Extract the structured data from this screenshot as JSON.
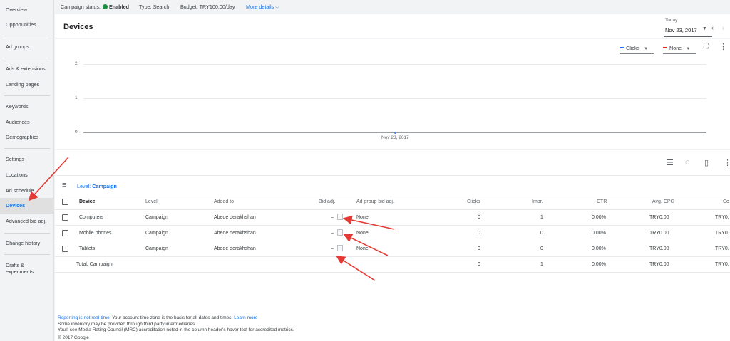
{
  "sidebar": {
    "items": [
      {
        "label": "Overview",
        "active": false
      },
      {
        "label": "Opportunities",
        "active": false
      },
      {
        "label": "Ad groups",
        "active": false
      },
      {
        "label": "Ads & extensions",
        "active": false
      },
      {
        "label": "Landing pages",
        "active": false
      },
      {
        "label": "Keywords",
        "active": false
      },
      {
        "label": "Audiences",
        "active": false
      },
      {
        "label": "Demographics",
        "active": false
      },
      {
        "label": "Settings",
        "active": false
      },
      {
        "label": "Locations",
        "active": false
      },
      {
        "label": "Ad schedule",
        "active": false
      },
      {
        "label": "Devices",
        "active": true
      },
      {
        "label": "Advanced bid adj.",
        "active": false
      },
      {
        "label": "Change history",
        "active": false
      },
      {
        "label": "Drafts &",
        "active": false
      },
      {
        "label": "experiments",
        "active": false
      }
    ]
  },
  "topbar": {
    "status_label": "Campaign status:",
    "status_value": "Enabled",
    "type": "Type: Search",
    "budget": "Budget: TRY100.00/day",
    "more_details": "More details"
  },
  "header": {
    "title": "Devices",
    "today_label": "Today",
    "date": "Nov 23, 2017"
  },
  "chart": {
    "metric1": "Clicks",
    "metric1_color": "#1a73e8",
    "metric2": "None",
    "metric2_color": "#d93025"
  },
  "chart_data": {
    "type": "line",
    "x": [
      "Nov 23, 2017"
    ],
    "series": [
      {
        "name": "Clicks",
        "values": [
          0
        ]
      }
    ],
    "yticks": [
      "2",
      "1",
      "0"
    ],
    "ylim": [
      0,
      2
    ],
    "grid": true
  },
  "table": {
    "level_prefix": "Level:",
    "level_value": "Campaign",
    "headers": {
      "device": "Device",
      "level": "Level",
      "added_to": "Added to",
      "bid_adj": "Bid adj.",
      "ag_bid_adj": "Ad group bid adj.",
      "clicks": "Clicks",
      "impr": "Impr.",
      "ctr": "CTR",
      "avg_cpc": "Avg. CPC",
      "cost": "Co"
    },
    "rows": [
      {
        "device": "Computers",
        "level": "Campaign",
        "added_to": "Abede derakhshan",
        "bid": "–",
        "ag_bid": "None",
        "clicks": "0",
        "impr": "1",
        "ctr": "0.00%",
        "avg_cpc": "TRY0.00",
        "cost": "TRY0."
      },
      {
        "device": "Mobile phones",
        "level": "Campaign",
        "added_to": "Abede derakhshan",
        "bid": "–",
        "ag_bid": "None",
        "clicks": "0",
        "impr": "0",
        "ctr": "0.00%",
        "avg_cpc": "TRY0.00",
        "cost": "TRY0."
      },
      {
        "device": "Tablets",
        "level": "Campaign",
        "added_to": "Abede derakhshan",
        "bid": "–",
        "ag_bid": "None",
        "clicks": "0",
        "impr": "0",
        "ctr": "0.00%",
        "avg_cpc": "TRY0.00",
        "cost": "TRY0."
      }
    ],
    "total": {
      "label": "Total: Campaign",
      "clicks": "0",
      "impr": "1",
      "ctr": "0.00%",
      "avg_cpc": "TRY0.00",
      "cost": "TRY0."
    }
  },
  "footer": {
    "line1_link": "Reporting is not real-time.",
    "line1_text": " Your account time zone is the basis for all dates and times.",
    "line1_link2": "Learn more",
    "line2": "Some inventory may be provided through third party intermediaries.",
    "line3": "You'll see Media Rating Council (MRC) accreditation noted in the column header's hover text for accredited metrics.",
    "copyright": "© 2017 Google"
  },
  "annotation_color": "#e53935"
}
